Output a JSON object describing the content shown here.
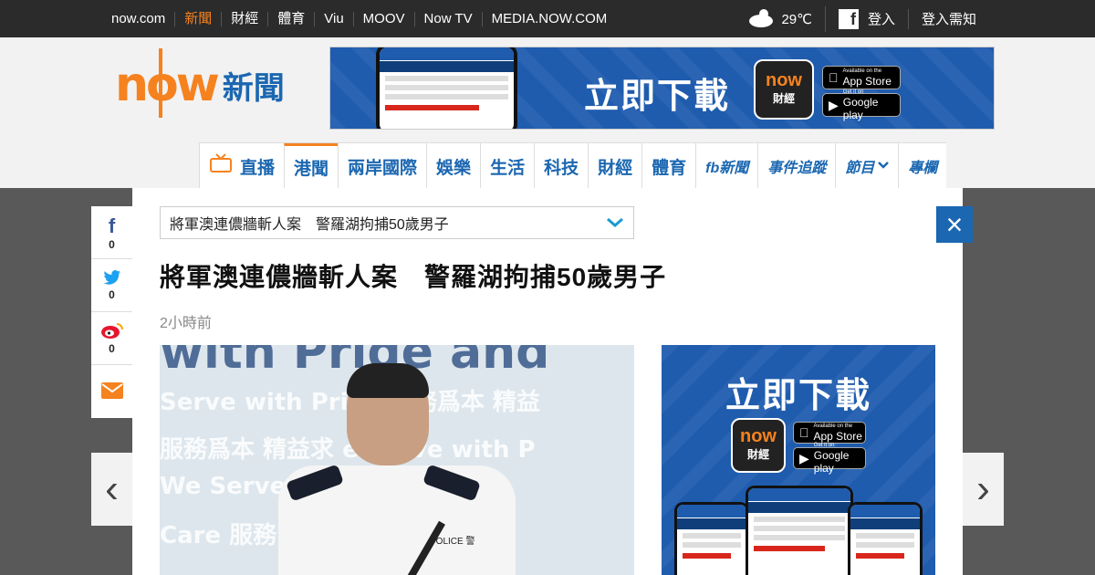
{
  "topbar": {
    "links": [
      "now.com",
      "新聞",
      "財經",
      "體育",
      "Viu",
      "MOOV",
      "Now TV",
      "MEDIA.NOW.COM"
    ],
    "active_index": 1,
    "weather": "29℃",
    "fb_login": "登入",
    "login_info": "登入需知"
  },
  "logo": {
    "now": "now",
    "news": "新聞"
  },
  "banner": {
    "headline": "立即下載",
    "app_name": "now",
    "app_sub": "財經",
    "appstore_small": "Available on the",
    "appstore": "App Store",
    "googleplay_small": "Get it on",
    "googleplay": "Google play"
  },
  "mainnav": {
    "items": [
      "直播",
      "港聞",
      "兩岸國際",
      "娛樂",
      "生活",
      "科技",
      "財經",
      "體育",
      "fb新聞",
      "事件追蹤",
      "節目",
      "專欄"
    ],
    "active_index": 1
  },
  "article": {
    "dropdown_value": "將軍澳連儂牆斬人案　警羅湖拘捕50歲男子",
    "title": "將軍澳連儂牆斬人案　警羅湖拘捕50歲男子",
    "time": "2小時前"
  },
  "photo": {
    "bg_text_1": "with Pride and",
    "bg_text_2": "Serve with Pride   服務爲本 精益",
    "bg_text_3": "服務爲本 精益求  e Serve with P",
    "bg_text_4": "We Serve    and Care",
    "bg_text_5": "Care 服務      e Serve with",
    "police": "POLICE 警"
  },
  "ad": {
    "headline": "立即下載",
    "app_name": "now",
    "app_sub": "財經",
    "appstore_small": "Available on the",
    "appstore": "App Store",
    "googleplay_small": "Get it on",
    "googleplay": "Google play"
  },
  "share": {
    "facebook": "0",
    "twitter": "0",
    "weibo": "0"
  },
  "controls": {
    "close": "×",
    "prev": "‹",
    "next": "›"
  },
  "colors": {
    "brand_orange": "#f5821f",
    "brand_blue": "#1b67b1",
    "topbar_bg": "#2b2b2b",
    "overlay": "#595959"
  }
}
